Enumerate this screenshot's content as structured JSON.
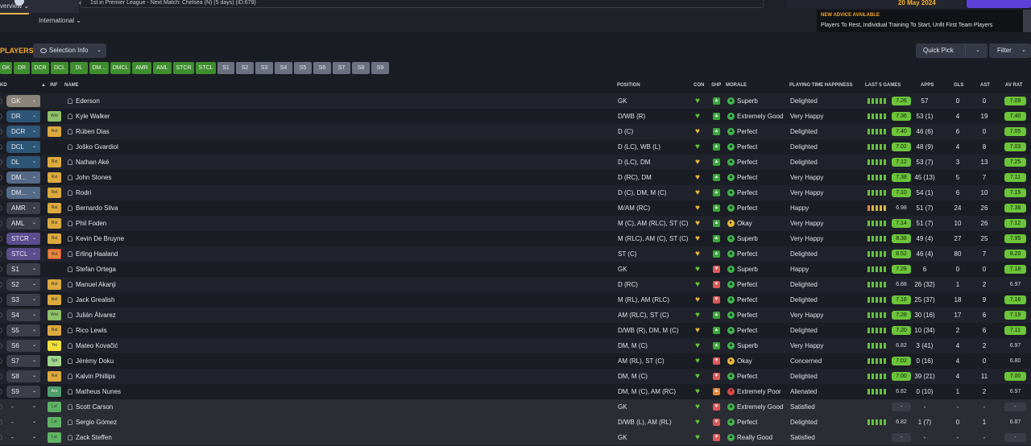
{
  "header": {
    "status": "1st in Premier League - Next Match: Chelsea (N) (5 days) (ID:679)",
    "date": "20 May 2024",
    "tabs": [
      {
        "label": "verview"
      },
      {
        "label": "International"
      }
    ],
    "advice_title": "NEW ADVICE AVAILABLE",
    "advice_text": "Players To Rest, Individual Training To Start, Unfit First Team Players"
  },
  "toolbar": {
    "section_title": "PLAYERS",
    "selection_info": "Selection Info",
    "quick_pick": "Quick Pick",
    "filter": "Filter"
  },
  "position_chips": [
    "GK",
    "DR",
    "DCR",
    "DCL",
    "DL",
    "DM...",
    "DMCL",
    "AMR",
    "AML",
    "STCR",
    "STCL",
    "S1",
    "S2",
    "S3",
    "S4",
    "S5",
    "S6",
    "S7",
    "S8",
    "S9"
  ],
  "columns": {
    "kd": "KD",
    "inf": "INF",
    "name": "NAME",
    "position": "POSITION",
    "con": "CON",
    "shp": "SHP",
    "morale": "MORALE",
    "pth": "PLAYING TIME HAPPINESS",
    "last5": "LAST 5 GAMES",
    "apps": "APPS",
    "gls": "GLS",
    "ast": "AST",
    "avrat": "AV RAT"
  },
  "colors": {
    "accent": "#f3a526",
    "good": "#6cc43a",
    "purple": "#5b3fd6"
  },
  "players": [
    {
      "slot": "GK",
      "inf": "",
      "name": "Ederson",
      "position": "GK",
      "morale": "Superb",
      "pth": "Delighted",
      "last5": "7.26",
      "apps": "57",
      "gls": "0",
      "ast": "0",
      "avrat": "7.09"
    },
    {
      "slot": "DR",
      "inf": "Wnt",
      "name": "Kyle Walker",
      "position": "D/WB (R)",
      "morale": "Extremely Good",
      "pth": "Very Happy",
      "last5": "7.36",
      "apps": "53 (1)",
      "gls": "4",
      "ast": "19",
      "avrat": "7.40"
    },
    {
      "slot": "DCR",
      "inf": "Rst",
      "name": "Rúben Dias",
      "position": "D (C)",
      "morale": "Perfect",
      "pth": "Delighted",
      "last5": "7.40",
      "apps": "46 (6)",
      "gls": "6",
      "ast": "0",
      "avrat": "7.05"
    },
    {
      "slot": "DCL",
      "inf": "",
      "name": "Joško Gvardiol",
      "position": "D (LC), WB (L)",
      "morale": "Perfect",
      "pth": "Delighted",
      "last5": "7.02",
      "apps": "48 (9)",
      "gls": "4",
      "ast": "8",
      "avrat": "7.03"
    },
    {
      "slot": "DL",
      "inf": "Rst",
      "name": "Nathan Aké",
      "position": "D (LC), DM",
      "morale": "Perfect",
      "pth": "Delighted",
      "last5": "7.12",
      "apps": "53 (7)",
      "gls": "3",
      "ast": "13",
      "avrat": "7.25"
    },
    {
      "slot": "DM...",
      "inf": "Rst",
      "name": "John Stones",
      "position": "D (RC), DM",
      "morale": "Perfect",
      "pth": "Very Happy",
      "last5": "7.38",
      "apps": "45 (13)",
      "gls": "5",
      "ast": "7",
      "avrat": "7.11"
    },
    {
      "slot": "DM...",
      "inf": "Rst",
      "name": "Rodri",
      "position": "D (C), DM, M (C)",
      "morale": "Perfect",
      "pth": "Very Happy",
      "last5": "7.10",
      "apps": "54 (1)",
      "gls": "6",
      "ast": "10",
      "avrat": "7.15"
    },
    {
      "slot": "AMR",
      "inf": "Rst",
      "name": "Bernardo Silva",
      "position": "M/AM (RC)",
      "morale": "Perfect",
      "pth": "Happy",
      "last5": "6.98",
      "apps": "51 (7)",
      "gls": "24",
      "ast": "26",
      "avrat": "7.38"
    },
    {
      "slot": "AML",
      "inf": "Rst",
      "name": "Phil Foden",
      "position": "M (C), AM (RLC), ST (C)",
      "morale": "Okay",
      "pth": "Very Happy",
      "last5": "7.14",
      "apps": "51 (7)",
      "gls": "10",
      "ast": "26",
      "avrat": "7.12"
    },
    {
      "slot": "STCR",
      "inf": "Rst",
      "name": "Kevin De Bruyne",
      "position": "M (RLC), AM (C), ST (C)",
      "morale": "Superb",
      "pth": "Very Happy",
      "last5": "8.38",
      "apps": "49 (4)",
      "gls": "27",
      "ast": "25",
      "avrat": "7.95"
    },
    {
      "slot": "STCL",
      "inf": "Rst",
      "name": "Erling Haaland",
      "position": "ST (C)",
      "morale": "Perfect",
      "pth": "Delighted",
      "last5": "8.52",
      "apps": "46 (4)",
      "gls": "80",
      "ast": "7",
      "avrat": "8.20"
    },
    {
      "slot": "S1",
      "inf": "",
      "name": "Stefan Ortega",
      "position": "GK",
      "morale": "Superb",
      "pth": "Happy",
      "last5": "7.28",
      "apps": "6",
      "gls": "0",
      "ast": "0",
      "avrat": "7.18"
    },
    {
      "slot": "S2",
      "inf": "Rst",
      "name": "Manuel Akanji",
      "position": "D (RC)",
      "morale": "Perfect",
      "pth": "Delighted",
      "last5": "6.88",
      "apps": "26 (32)",
      "gls": "1",
      "ast": "2",
      "avrat": "6.97"
    },
    {
      "slot": "S3",
      "inf": "Rst",
      "name": "Jack Grealish",
      "position": "M (RL), AM (RLC)",
      "morale": "Perfect",
      "pth": "Delighted",
      "last5": "7.18",
      "apps": "25 (37)",
      "gls": "18",
      "ast": "9",
      "avrat": "7.16"
    },
    {
      "slot": "S4",
      "inf": "Wnt",
      "name": "Julián Álvarez",
      "position": "AM (RLC), ST (C)",
      "morale": "Perfect",
      "pth": "Very Happy",
      "last5": "7.28",
      "apps": "30 (16)",
      "gls": "17",
      "ast": "6",
      "avrat": "7.19"
    },
    {
      "slot": "S5",
      "inf": "Rst",
      "name": "Rico Lewis",
      "position": "D/WB (R), DM, M (C)",
      "morale": "Perfect",
      "pth": "Delighted",
      "last5": "7.20",
      "apps": "10 (34)",
      "gls": "2",
      "ast": "6",
      "avrat": "7.11"
    },
    {
      "slot": "S6",
      "inf": "Yel",
      "name": "Mateo Kovačić",
      "position": "DM, M (C)",
      "morale": "Superb",
      "pth": "Very Happy",
      "last5": "6.82",
      "apps": "3 (41)",
      "gls": "4",
      "ast": "2",
      "avrat": "6.97"
    },
    {
      "slot": "S7",
      "inf": "Spt",
      "name": "Jérémy Doku",
      "position": "AM (RL), ST (C)",
      "morale": "Okay",
      "pth": "Concerned",
      "last5": "7.02",
      "apps": "0 (16)",
      "gls": "4",
      "ast": "0",
      "avrat": "6.80"
    },
    {
      "slot": "S8",
      "inf": "Rst",
      "name": "Kalvin Phillips",
      "position": "DM, M (C)",
      "morale": "Perfect",
      "pth": "Delighted",
      "last5": "7.00",
      "apps": "39 (21)",
      "gls": "4",
      "ast": "11",
      "avrat": "7.00"
    },
    {
      "slot": "S9",
      "inf": "Anr",
      "name": "Matheus Nunes",
      "position": "DM, M (C), AM (RC)",
      "morale": "Extremely Poor",
      "pth": "Alienated",
      "last5": "6.82",
      "apps": "0 (10)",
      "gls": "1",
      "ast": "2",
      "avrat": "6.97"
    },
    {
      "slot": "-",
      "inf": "Lst",
      "name": "Scott Carson",
      "position": "GK",
      "morale": "Extremely Good",
      "pth": "Satisfied",
      "last5": "-",
      "apps": "-",
      "gls": "-",
      "ast": "-",
      "avrat": "-"
    },
    {
      "slot": "-",
      "inf": "Lst",
      "name": "Sergio Gómez",
      "position": "D/WB (L), AM (RL)",
      "morale": "Perfect",
      "pth": "Delighted",
      "last5": "6.82",
      "apps": "1 (7)",
      "gls": "0",
      "ast": "1",
      "avrat": "6.87"
    },
    {
      "slot": "-",
      "inf": "Lst",
      "name": "Zack Steffen",
      "position": "GK",
      "morale": "Really Good",
      "pth": "Satisfied",
      "last5": "-",
      "apps": "-",
      "gls": "-",
      "ast": "-",
      "avrat": "-"
    }
  ]
}
